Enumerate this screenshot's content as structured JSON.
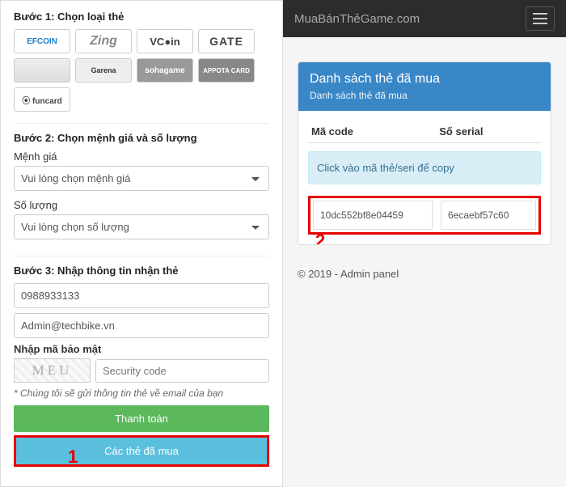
{
  "left": {
    "step1_title": "Bước 1: Chọn loại thẻ",
    "cards": [
      {
        "key": "efcoin",
        "label": "EFCOIN"
      },
      {
        "key": "zing",
        "label": "Zing"
      },
      {
        "key": "vcoin",
        "label": "VC●in"
      },
      {
        "key": "gate",
        "label": "GATE"
      },
      {
        "key": "gray",
        "label": ""
      },
      {
        "key": "garena",
        "label": "Garena"
      },
      {
        "key": "soha",
        "label": "sohagame"
      },
      {
        "key": "appota",
        "label": "APPOTA CARD"
      },
      {
        "key": "funcard",
        "label": "⦿ funcard"
      }
    ],
    "step2_title": "Bước 2: Chọn mệnh giá và số lượng",
    "denom_label": "Mệnh giá",
    "denom_placeholder": "Vui lòng chọn mệnh giá",
    "qty_label": "Số lượng",
    "qty_placeholder": "Vui lòng chọn số lượng",
    "step3_title": "Bước 3: Nhập thông tin nhận thẻ",
    "phone_value": "0988933133",
    "email_value": "Admin@techbike.vn",
    "captcha_label": "Nhập mã bảo mật",
    "captcha_text": "MEU",
    "captcha_placeholder": "Security code",
    "hint": "* Chúng tôi sẽ gửi thông tin thẻ về email của bạn",
    "pay_btn": "Thanh toán",
    "bought_btn": "Các thẻ đã mua",
    "annot1": "1"
  },
  "right": {
    "brand": "MuaBánThẻGame.com",
    "panel_title": "Danh sách thẻ đã mua",
    "panel_sub": "Danh sách thẻ đã mua",
    "th_code": "Mã code",
    "th_serial": "Số serial",
    "info": "Click vào mã thẻ/seri để copy",
    "row_code": "10dc552bf8e04459",
    "row_serial": "6ecaebf57c60",
    "annot2": "2",
    "footer": "© 2019 - Admin panel"
  }
}
